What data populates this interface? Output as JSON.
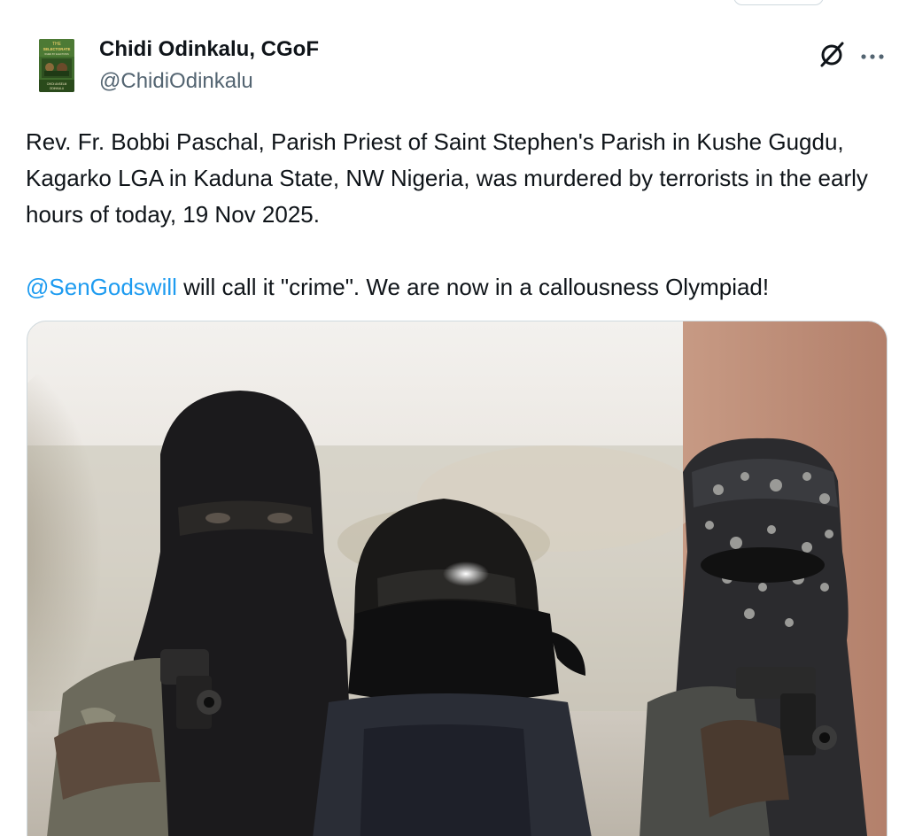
{
  "author": {
    "name": "Chidi Odinkalu, CGoF",
    "handle": "@ChidiOdinkalu",
    "avatar_book": {
      "title_line1": "THE",
      "title_line2": "SELECTORATE",
      "subtitle": "WHEN BY ELECTIONS",
      "author_line1": "CHIDI ANSELM",
      "author_line2": "ODINKALU"
    }
  },
  "tweet": {
    "paragraph1": "Rev. Fr. Bobbi Paschal, Parish Priest of Saint Stephen's Parish in Kushe Gugdu, Kagarko LGA in Kaduna State, NW Nigeria, was murdered by terrorists in the early hours of today, 19 Nov 2025.",
    "mention": "@SenGodswill",
    "paragraph2_rest": " will call it \"crime\". We are now in a callousness Olympiad!"
  },
  "icons": {
    "grok": "grok-icon",
    "more": "more-icon"
  },
  "colors": {
    "link": "#1d9bf0",
    "text": "#0f1419",
    "secondary": "#536471",
    "border": "#cfd9de"
  }
}
